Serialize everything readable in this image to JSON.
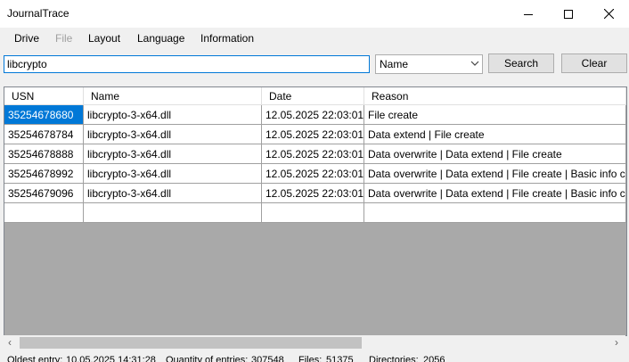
{
  "window": {
    "title": "JournalTrace"
  },
  "menu": [
    "Drive",
    "File",
    "Layout",
    "Language",
    "Information"
  ],
  "toolbar": {
    "search_value": "libcrypto",
    "field_selected": "Name",
    "search_label": "Search",
    "clear_label": "Clear"
  },
  "table": {
    "columns": [
      "USN",
      "Name",
      "Date",
      "Reason"
    ],
    "rows": [
      [
        "35254678680",
        "libcrypto-3-x64.dll",
        "12.05.2025 22:03:01",
        "File create"
      ],
      [
        "35254678784",
        "libcrypto-3-x64.dll",
        "12.05.2025 22:03:01",
        "Data extend | File create"
      ],
      [
        "35254678888",
        "libcrypto-3-x64.dll",
        "12.05.2025 22:03:01",
        "Data overwrite | Data extend | File create"
      ],
      [
        "35254678992",
        "libcrypto-3-x64.dll",
        "12.05.2025 22:03:01",
        "Data overwrite | Data extend | File create | Basic info change"
      ],
      [
        "35254679096",
        "libcrypto-3-x64.dll",
        "12.05.2025 22:03:01",
        "Data overwrite | Data extend | File create | Basic info chang..."
      ]
    ]
  },
  "status": {
    "oldest_label": "Oldest entry:",
    "oldest_value": "10.05.2025 14:31:28",
    "quantity_label": "Quantity of entries:",
    "quantity_value": "307548",
    "files_label": "Files:",
    "files_value": "51375",
    "dirs_label": "Directories:",
    "dirs_value": "2056"
  }
}
